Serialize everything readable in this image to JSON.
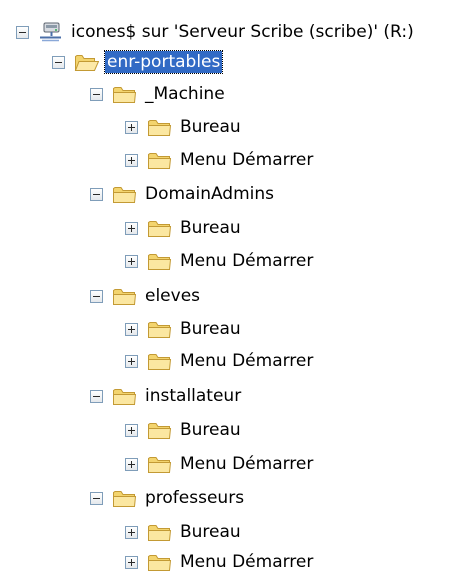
{
  "tree": {
    "root": {
      "label": "icones$ sur 'Serveur Scribe (scribe)' (R:)",
      "expanded": true,
      "icon": "network-drive-icon"
    },
    "folder": {
      "label": "enr-portables",
      "expanded": true,
      "selected": true,
      "icon": "folder-open-icon"
    },
    "groups": [
      {
        "label": "_Machine",
        "expanded": true,
        "children": [
          {
            "label": "Bureau",
            "expanded": false
          },
          {
            "label": "Menu Démarrer",
            "expanded": false
          }
        ]
      },
      {
        "label": "DomainAdmins",
        "expanded": true,
        "children": [
          {
            "label": "Bureau",
            "expanded": false
          },
          {
            "label": "Menu Démarrer",
            "expanded": false
          }
        ]
      },
      {
        "label": "eleves",
        "expanded": true,
        "children": [
          {
            "label": "Bureau",
            "expanded": false
          },
          {
            "label": "Menu Démarrer",
            "expanded": false
          }
        ]
      },
      {
        "label": "installateur",
        "expanded": true,
        "children": [
          {
            "label": "Bureau",
            "expanded": false
          },
          {
            "label": "Menu Démarrer",
            "expanded": false
          }
        ]
      },
      {
        "label": "professeurs",
        "expanded": true,
        "children": [
          {
            "label": "Bureau",
            "expanded": false
          },
          {
            "label": "Menu Démarrer",
            "expanded": false
          }
        ]
      }
    ],
    "colors": {
      "selection": "#316ac5",
      "folder": "#f5d77a",
      "folder_outline": "#c8a13b"
    }
  }
}
